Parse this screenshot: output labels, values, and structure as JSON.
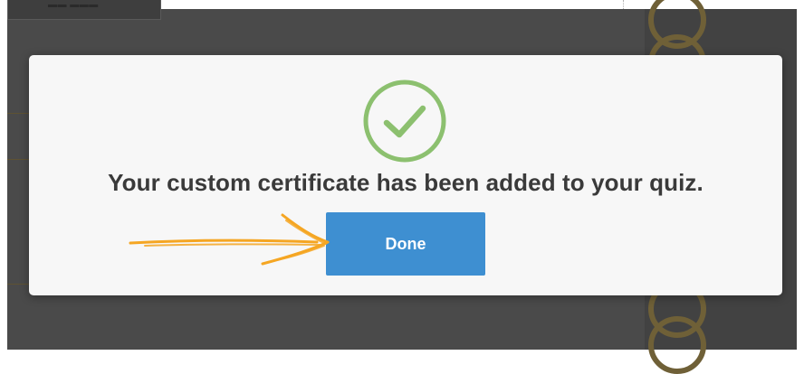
{
  "dialog": {
    "message": "Your custom certificate has been added to your quiz.",
    "done_label": "Done",
    "success_icon": "check-circle-icon",
    "annotation_icon": "hand-drawn-arrow-icon"
  },
  "colors": {
    "button": "#3e8fd1",
    "check": "#8cc06f",
    "arrow": "#f5a623",
    "overlay": "#4a4a4a"
  }
}
